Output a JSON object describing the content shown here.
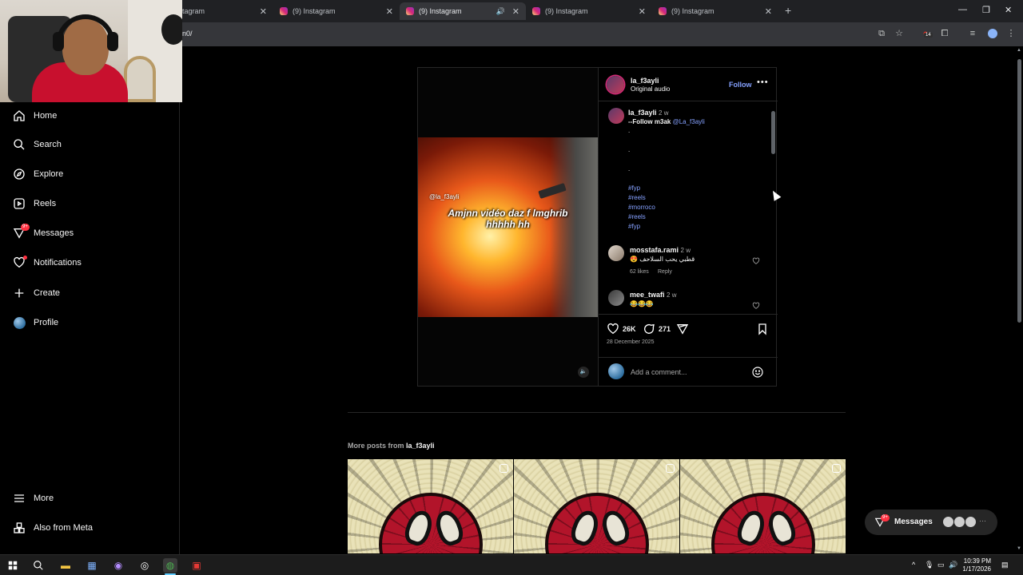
{
  "browser": {
    "tabs": [
      {
        "label": "tagram"
      },
      {
        "label": "(9) Instagram"
      },
      {
        "label": "(9) Instagram"
      },
      {
        "label": "(9) Instagram"
      },
      {
        "label": "(9) Instagram"
      }
    ],
    "active_tab_index": 2,
    "url": "n0/",
    "extension_badge": "14"
  },
  "sidebar": {
    "items": [
      {
        "label": "Home",
        "icon": "home-icon"
      },
      {
        "label": "Search",
        "icon": "search-icon"
      },
      {
        "label": "Explore",
        "icon": "compass-icon"
      },
      {
        "label": "Reels",
        "icon": "reels-icon"
      },
      {
        "label": "Messages",
        "icon": "messenger-icon",
        "badge": "9+"
      },
      {
        "label": "Notifications",
        "icon": "heart-icon",
        "dot": true
      },
      {
        "label": "Create",
        "icon": "plus-icon"
      },
      {
        "label": "Profile",
        "icon": "profile-avatar"
      }
    ],
    "bottom": [
      {
        "label": "More",
        "icon": "menu-icon"
      },
      {
        "label": "Also from Meta",
        "icon": "meta-icon"
      }
    ]
  },
  "post": {
    "video": {
      "handle_overlay": "@la_f3ayli",
      "caption_line1": "Amjnn vidéo daz f lmghrib",
      "caption_line2": "hhhhh hh"
    },
    "author": {
      "username": "la_f3ayli",
      "audio": "Original audio"
    },
    "follow_label": "Follow",
    "caption": {
      "username": "la_f3ayli",
      "time": "2 w",
      "text": "--Follow m3ak⁣⁣⁣⁣",
      "mention": "@La_f3ayli",
      "dots": [
        ".",
        ".",
        "."
      ],
      "hashtags": [
        "#fyp",
        "#reels",
        "#morroco",
        "#reels",
        "#fyp"
      ]
    },
    "comments": [
      {
        "username": "mosstafa.rami",
        "time": "2 w",
        "text": "😍 قطبي يحب السلاحف",
        "likes": "62 likes",
        "reply": "Reply"
      },
      {
        "username": "mee_twafi",
        "time": "2 w",
        "text": "😂😂😂"
      }
    ],
    "likes_count": "26K",
    "comments_count": "271",
    "date": "28 December 2025",
    "add_comment_placeholder": "Add a comment..."
  },
  "more_posts": {
    "prefix": "More posts from",
    "username": "la_f3ayli"
  },
  "messages_pill": {
    "label": "Messages",
    "badge": "9+"
  },
  "taskbar": {
    "time": "10:39 PM",
    "date": "1/17/2026"
  }
}
